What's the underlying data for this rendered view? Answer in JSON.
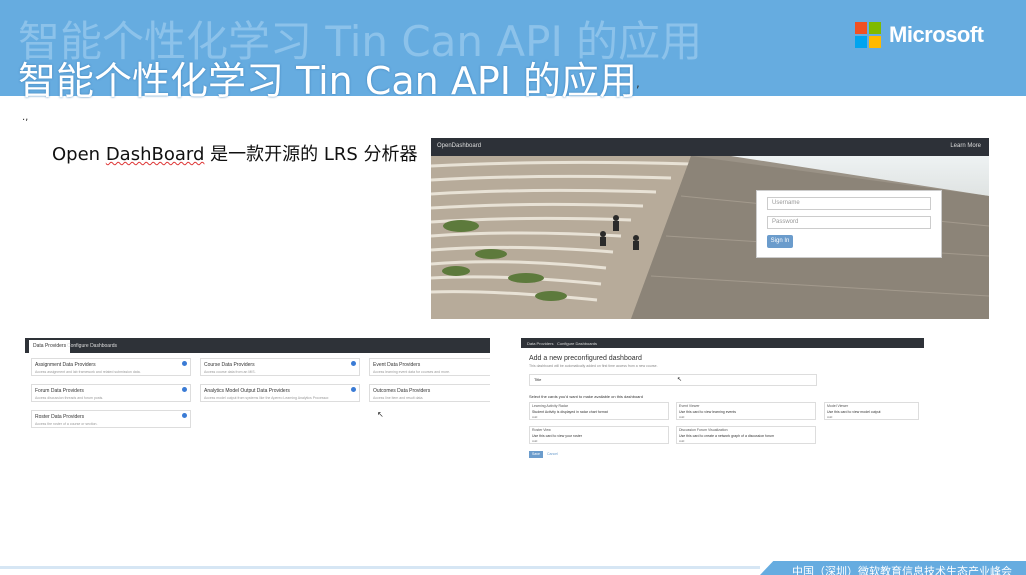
{
  "header": {
    "title": "智能个性化学习 Tin Can API 的应用",
    "title_mark": ",",
    "logo_text": "Microsoft",
    "colors": {
      "bar": "#66ace0",
      "logo_red": "#f25022",
      "logo_green": "#7fba00",
      "logo_blue": "#00a4ef",
      "logo_yellow": "#ffb900"
    }
  },
  "bullet_mark": ".,",
  "subtitle": {
    "part1": "Open ",
    "part2": "DashBoard",
    "part3": " 是一款开源的 LRS 分析器"
  },
  "screenshot_login": {
    "brand": "OpenDashboard",
    "nav_link": "Learn More",
    "username_placeholder": "Username",
    "password_placeholder": "Password",
    "signin": "Sign In"
  },
  "screenshot_providers": {
    "tabs": [
      "Data Providers",
      "Configure Dashboards"
    ],
    "providers": [
      {
        "title": "Assignment Data Providers",
        "desc": "Access assignment and lab framework and related submission data."
      },
      {
        "title": "Course Data Providers",
        "desc": "Access course data from an MIS."
      },
      {
        "title": "Event Data Providers",
        "desc": "Access learning event data for courses and more."
      },
      {
        "title": "Forum Data Providers",
        "desc": "Access discussion threads and forum posts."
      },
      {
        "title": "Analytics Model Output Data Providers",
        "desc": "Access model output from systems like the Apereo Learning Analytics Processor."
      },
      {
        "title": "Outcomes Data Providers",
        "desc": "Access line item and result data."
      },
      {
        "title": "Roster Data Providers",
        "desc": "Access the roster of a course or section."
      }
    ]
  },
  "screenshot_dashboard": {
    "tabs": [
      "Data Providers",
      "Configure Dashboards"
    ],
    "heading": "Add a new preconfigured dashboard",
    "subheading": "This dashboard will be automatically added on first time access from a new course.",
    "title_label": "Title",
    "cards_label": "Select the cards you'd want to make available on this dashboard",
    "cards": [
      {
        "title": "Learning Activity Radar",
        "desc": "Student Activity is displayed in radar chart format",
        "add": "Add"
      },
      {
        "title": "Event Viewer",
        "desc": "Use this card to view learning events",
        "add": "Add"
      },
      {
        "title": "Model Viewer",
        "desc": "Use this card to view model output",
        "add": "Add"
      },
      {
        "title": "Roster View",
        "desc": "Use this card to view your roster",
        "add": "Add"
      },
      {
        "title": "Discussion Forum Visualization",
        "desc": "Use this card to create a network graph of a discussion forum",
        "add": "Add"
      }
    ],
    "save": "Save",
    "cancel": "Cancel"
  },
  "footer": {
    "text": "中国（深圳）微软教育信息技术生态产业峰会"
  }
}
